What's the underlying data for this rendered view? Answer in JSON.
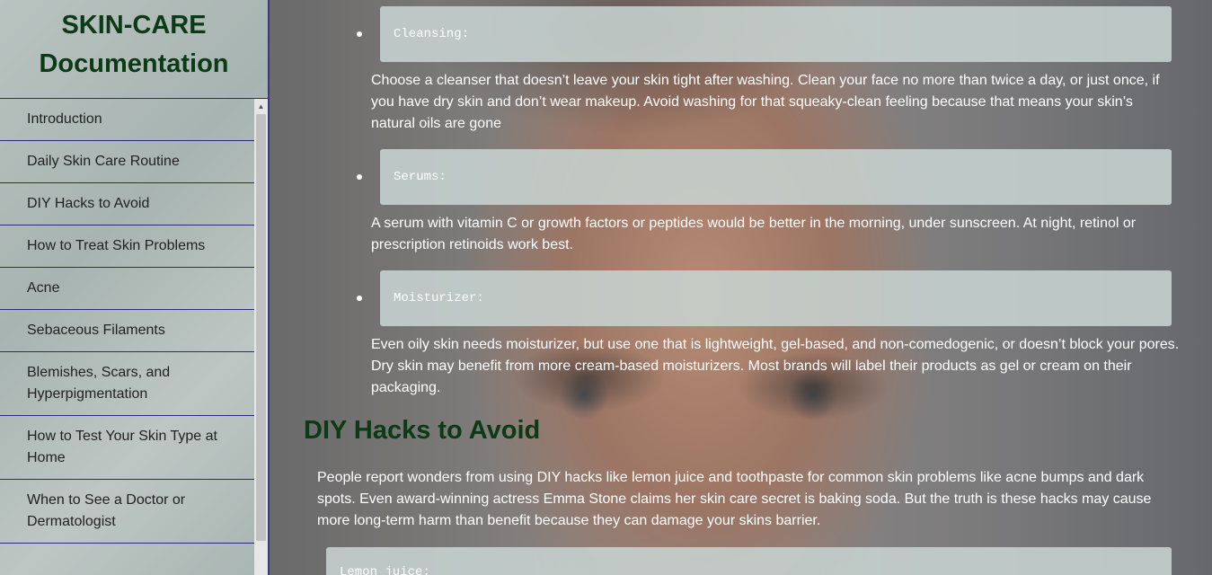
{
  "sidebar": {
    "title_line1": "SKIN-CARE",
    "title_line2": "Documentation",
    "items": [
      {
        "label": "Introduction"
      },
      {
        "label": "Daily Skin Care Routine"
      },
      {
        "label": "DIY Hacks to Avoid"
      },
      {
        "label": "How to Treat Skin Problems"
      },
      {
        "label": "Acne"
      },
      {
        "label": "Sebaceous Filaments"
      },
      {
        "label": "Blemishes, Scars, and Hyperpigmentation"
      },
      {
        "label": "How to Test Your Skin Type at Home"
      },
      {
        "label": "When to See a Doctor or Dermatologist"
      }
    ]
  },
  "main": {
    "routine_steps": [
      {
        "code": "Cleansing:",
        "text": "Choose a cleanser that doesn’t leave your skin tight after washing. Clean your face no more than twice a day, or just once, if you have dry skin and don’t wear makeup. Avoid washing for that squeaky-clean feeling because that means your skin’s natural oils are gone"
      },
      {
        "code": "Serums:",
        "text": "A serum with vitamin C or growth factors or peptides would be better in the morning, under sunscreen. At night, retinol or prescription retinoids work best."
      },
      {
        "code": "Moisturizer:",
        "text": "Even oily skin needs moisturizer, but use one that is lightweight, gel-based, and non-comedogenic, or doesn’t block your pores. Dry skin may benefit from more cream-based moisturizers. Most brands will label their products as gel or cream on their packaging."
      }
    ],
    "diy_section": {
      "title": "DIY Hacks to Avoid",
      "paragraph": "People report wonders from using DIY hacks like lemon juice and toothpaste for common skin problems like acne bumps and dark spots. Even award-winning actress Emma Stone claims her skin care secret is baking soda. But the truth is these hacks may cause more long-term harm than benefit because they can damage your skins barrier.",
      "next_code": "Lemon juice:"
    }
  },
  "colors": {
    "heading_green": "#0b3a16",
    "nav_border": "#2b2b7a",
    "code_box_bg": "#c7d3d0"
  }
}
